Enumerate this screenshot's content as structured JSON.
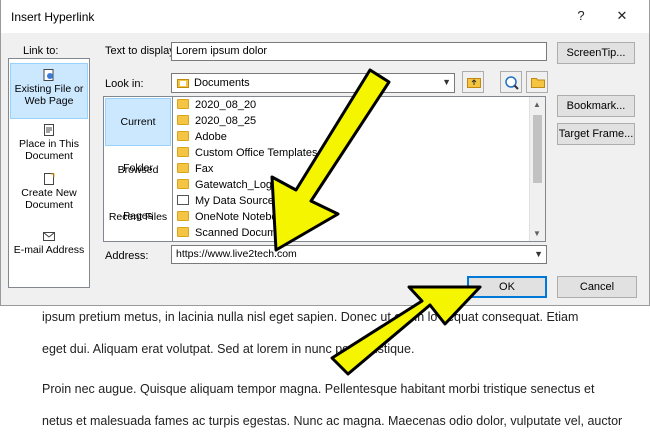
{
  "dialog": {
    "title": "Insert Hyperlink",
    "help_label": "?",
    "close_label": "✕"
  },
  "link_to": {
    "label": "Link to:",
    "items": [
      {
        "label": "Existing File or Web Page",
        "icon": "web-page-icon",
        "active": true
      },
      {
        "label": "Place in This Document",
        "icon": "place-document-icon",
        "active": false
      },
      {
        "label": "Create New Document",
        "icon": "new-document-icon",
        "active": false
      },
      {
        "label": "E-mail Address",
        "icon": "email-icon",
        "active": false
      }
    ]
  },
  "text_to_display": {
    "label": "Text to display:",
    "value": "Lorem ipsum dolor"
  },
  "screentip_button": "ScreenTip...",
  "look_in": {
    "label": "Look in:",
    "value": "Documents"
  },
  "nav": {
    "current_folder": "Current Folder",
    "browsed_pages": "Browsed Pages",
    "recent_files": "Recent Files"
  },
  "files": [
    {
      "name": "2020_08_20",
      "icon": "folder-icon"
    },
    {
      "name": "2020_08_25",
      "icon": "folder-icon"
    },
    {
      "name": "Adobe",
      "icon": "folder-icon"
    },
    {
      "name": "Custom Office Templates",
      "icon": "folder-icon"
    },
    {
      "name": "Fax",
      "icon": "folder-icon"
    },
    {
      "name": "Gatewatch_Logs",
      "icon": "folder-icon"
    },
    {
      "name": "My Data Sources",
      "icon": "data-source-icon"
    },
    {
      "name": "OneNote Notebooks",
      "icon": "folder-icon"
    },
    {
      "name": "Scanned Documents",
      "icon": "folder-icon"
    }
  ],
  "side_buttons": {
    "bookmark": "Bookmark...",
    "target_frame": "Target Frame..."
  },
  "address": {
    "label": "Address:",
    "value": "https://www.live2tech.com"
  },
  "ok_button": "OK",
  "cancel_button": "Cancel",
  "document_text": {
    "line1": "ipsum pretium metus, in lacinia nulla nisl eget sapien. Donec ut est in lo              sequat consequat. Etiam",
    "line2": "eget dui. Aliquam erat volutpat. Sed at lorem in nunc porta tristique.",
    "line3": "Proin nec augue. Quisque aliquam tempor magna. Pellentesque habitant morbi tristique senectus et",
    "line4": "netus et malesuada fames ac turpis egestas. Nunc ac magna. Maecenas odio dolor, vulputate vel, auctor"
  },
  "colors": {
    "dialog_bg": "#f0f0f0",
    "selection": "#cce8ff",
    "accent": "#0078d7",
    "arrow_fill": "#f5f500",
    "arrow_stroke": "#000000"
  }
}
